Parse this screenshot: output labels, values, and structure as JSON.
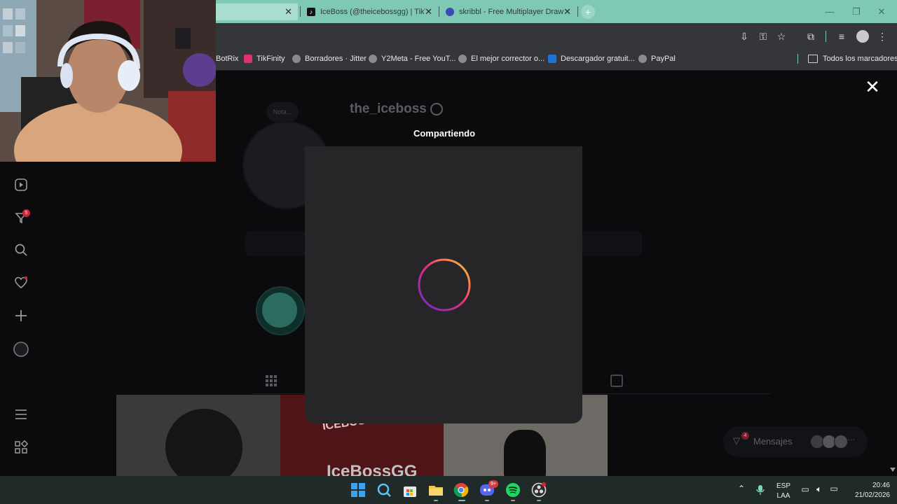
{
  "browser": {
    "tabs": [
      {
        "title": "",
        "closeable": true
      },
      {
        "title": "IceBoss (@theicebossgg) | TikTo",
        "favicon": "tiktok-icon"
      },
      {
        "title": "skribbl - Free Multiplayer Draw",
        "favicon": "skribbl-icon"
      }
    ],
    "new_tab_label": "+",
    "bookmarks": [
      {
        "label": "BotRix",
        "icon": "none"
      },
      {
        "label": "TikFinity",
        "icon": "tikfinity-icon"
      },
      {
        "label": "Borradores · Jitter",
        "icon": "globe-icon"
      },
      {
        "label": "Y2Meta - Free YouT...",
        "icon": "globe-icon"
      },
      {
        "label": "El mejor corrector o...",
        "icon": "globe-icon"
      },
      {
        "label": "Descargador gratuit...",
        "icon": "infinity-icon"
      },
      {
        "label": "PayPal",
        "icon": "globe-icon"
      }
    ],
    "all_bookmarks_label": "Todos los marcadores"
  },
  "profile": {
    "username": "the_iceboss",
    "note_label": "Nota...",
    "notifications_badge": "5"
  },
  "modal": {
    "title": "Compartiendo",
    "close_symbol": "✕"
  },
  "messages": {
    "label": "Mensajes",
    "badge": "4",
    "more": "···"
  },
  "posts": {
    "overlay_text_1": "ICEBOSS",
    "overlay_text_2": "IceBossGG"
  },
  "taskbar": {
    "discord_badge": "9+",
    "language": "ESP",
    "layout": "LAA",
    "time": "20:46",
    "date": "21/02/2026"
  },
  "colors": {
    "tab_strip": "#7fc9b4",
    "toolbar": "#35363a",
    "modal": "#262628",
    "spinner_start": "#f9ce34",
    "spinner_mid": "#ee2a7b",
    "spinner_end": "#6228d7"
  }
}
